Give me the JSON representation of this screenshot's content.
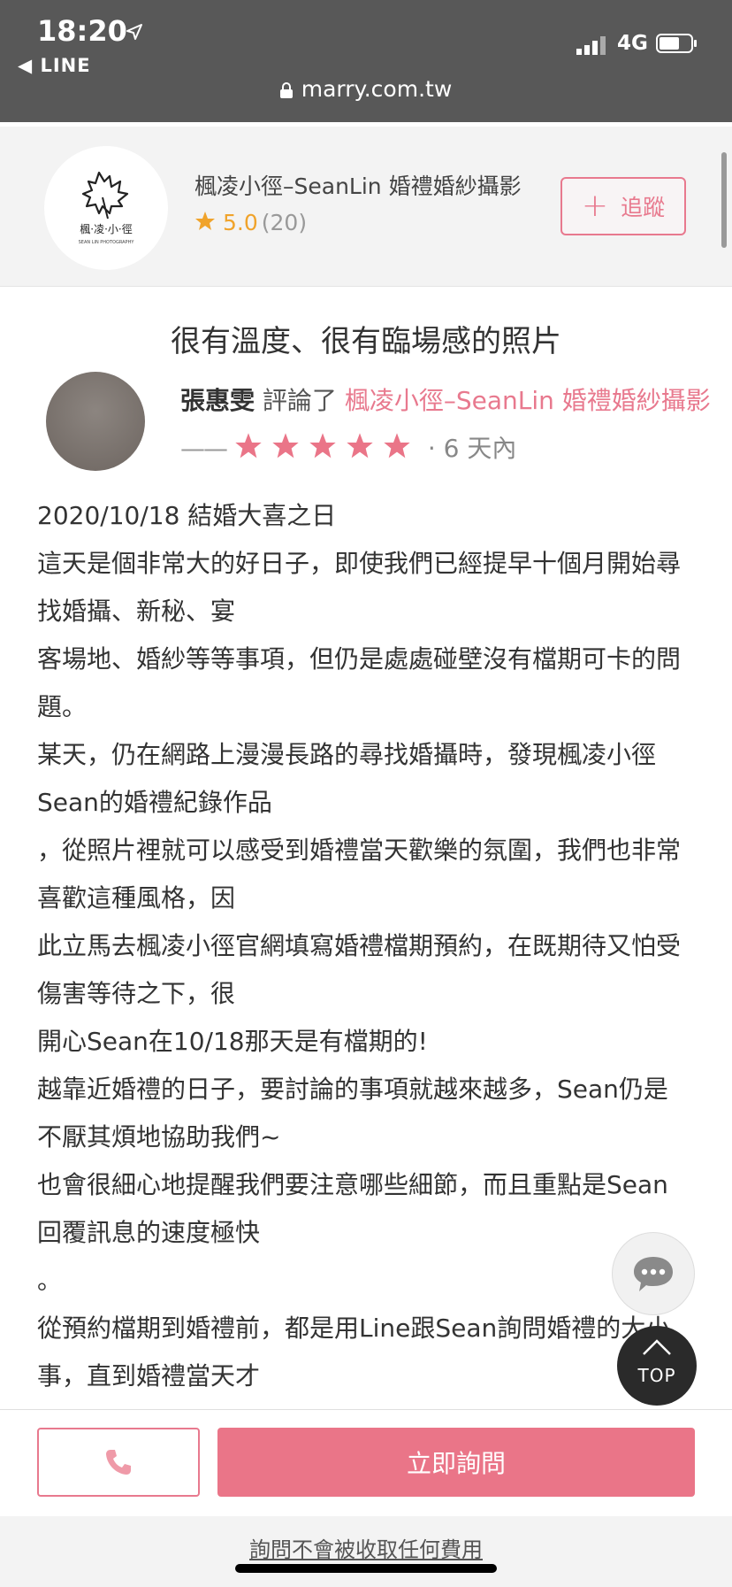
{
  "status_bar": {
    "time": "18:20",
    "back_app": "◀ LINE",
    "network": "4G"
  },
  "browser": {
    "url": "marry.com.tw"
  },
  "vendor": {
    "logo_text_cn": "楓·凌·小·徑",
    "logo_text_en": "SEAN LIN PHOTOGRAPHY",
    "name": "楓凌小徑–SeanLin 婚禮婚紗攝影",
    "rating": "5.0",
    "review_count": "(20)",
    "follow_label": "追蹤",
    "follow_plus": "+"
  },
  "review": {
    "title": "很有溫度、很有臨場感的照片",
    "author": "張惠雯",
    "reviewed_label": "評論了",
    "vendor_link": "楓凌小徑–SeanLin 婚禮婚紗攝影",
    "separator": "——",
    "star_count": 5,
    "time_ago": "· 6 天內",
    "paragraphs": [
      "2020/10/18 結婚大喜之日",
      "這天是個非常大的好日子，即使我們已經提早十個月開始尋找婚攝、新秘、宴",
      "客場地、婚紗等等事項，但仍是處處碰壁沒有檔期可卡的問題。",
      "某天，仍在網路上漫漫長路的尋找婚攝時，發現楓凌小徑Sean的婚禮紀錄作品",
      "，從照片裡就可以感受到婚禮當天歡樂的氛圍，我們也非常喜歡這種風格，因",
      "此立馬去楓凌小徑官網填寫婚禮檔期預約，在既期待又怕受傷害等待之下，很",
      "開心Sean在10/18那天是有檔期的!",
      "越靠近婚禮的日子，要討論的事項就越來越多，Sean仍是不厭其煩地協助我們~",
      "也會很細心地提醒我們要注意哪些細節，而且重點是Sean回覆訊息的速度極快",
      "。",
      "從預約檔期到婚禮前，都是用Line跟Sean詢問婚禮的大小事，直到婚禮當天才"
    ]
  },
  "floating": {
    "top_label": "TOP"
  },
  "bottom_bar": {
    "ask_label": "立即詢問",
    "note": "詢問不會被收取任何費用"
  },
  "colors": {
    "brand_pink": "#ea7588",
    "star_gold": "#f0a32b"
  }
}
